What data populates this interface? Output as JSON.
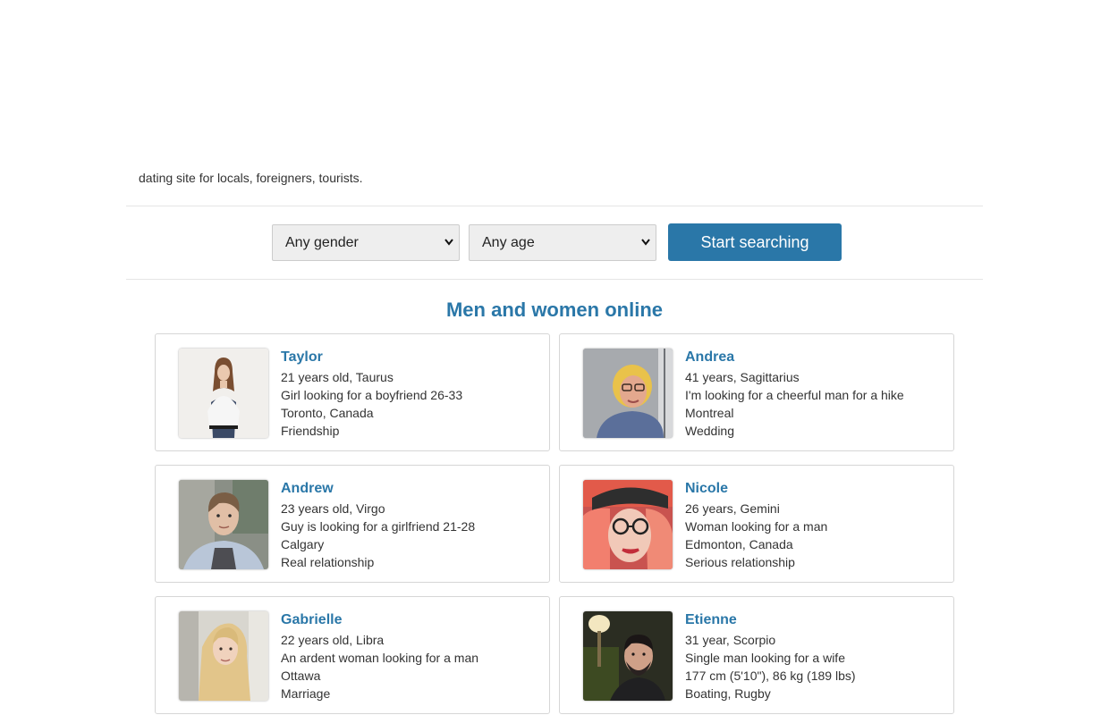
{
  "intro": {
    "text": "dating site for locals, foreigners, tourists."
  },
  "search": {
    "gender_selected": "Any gender",
    "age_selected": "Any age",
    "button_label": "Start searching"
  },
  "section": {
    "title": "Men and women online"
  },
  "profiles": [
    {
      "name": "Taylor",
      "line1": "21 years old, Taurus",
      "line2": "Girl looking for a boyfriend 26-33",
      "line3": "Toronto, Canada",
      "line4": "Friendship"
    },
    {
      "name": "Andrea",
      "line1": "41 years, Sagittarius",
      "line2": "I'm looking for a cheerful man for a hike",
      "line3": "Montreal",
      "line4": "Wedding"
    },
    {
      "name": "Andrew",
      "line1": "23 years old, Virgo",
      "line2": "Guy is looking for a girlfriend 21-28",
      "line3": "Calgary",
      "line4": "Real relationship"
    },
    {
      "name": "Nicole",
      "line1": "26 years, Gemini",
      "line2": "Woman looking for a man",
      "line3": "Edmonton, Canada",
      "line4": "Serious relationship"
    },
    {
      "name": "Gabrielle",
      "line1": "22 years old, Libra",
      "line2": "An ardent woman looking for a man",
      "line3": "Ottawa",
      "line4": "Marriage"
    },
    {
      "name": "Etienne",
      "line1": "31 year, Scorpio",
      "line2": "Single man looking for a wife",
      "line3": "177 cm (5'10\"), 86 kg (189 lbs)",
      "line4": "Boating, Rugby"
    }
  ],
  "colors": {
    "accent": "#2a77a8",
    "divider": "#e5e5e5"
  }
}
